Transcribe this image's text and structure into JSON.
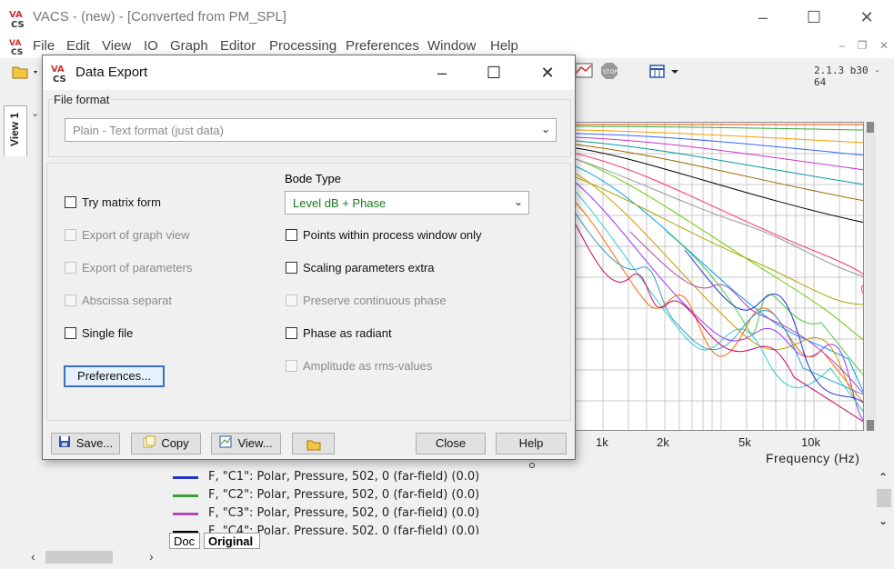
{
  "app": {
    "title": "VACS - (new) - [Converted from PM_SPL]",
    "version": "2.1.3 b30 - 64"
  },
  "menu": [
    "File",
    "Edit",
    "View",
    "IO",
    "Graph",
    "Editor",
    "Processing",
    "Preferences",
    "Window",
    "Help"
  ],
  "view_tab": "View 1",
  "graph": {
    "x_ticks": [
      "1k",
      "2k",
      "5k",
      "10k"
    ],
    "x_label": "Frequency (Hz)"
  },
  "legend": [
    {
      "text": "F, \"C1\": Polar, Pressure, 502, 0 (far-field) (0.0)",
      "color": "#2233cc"
    },
    {
      "text": "F, \"C2\": Polar, Pressure, 502, 0 (far-field) (0.0)",
      "color": "#3aa03a"
    },
    {
      "text": "F, \"C3\": Polar, Pressure, 502, 0 (far-field) (0.0)",
      "color": "#b04ab0"
    },
    {
      "text": "F, \"C4\": Polar, Pressure, 502, 0 (far-field) (0.0)",
      "color": "#000000"
    }
  ],
  "bottom_tabs": [
    "Doc",
    "Original"
  ],
  "dialog": {
    "title": "Data Export",
    "file_format_label": "File format",
    "file_format_value": "Plain - Text format (just data)",
    "bode_type_label": "Bode Type",
    "bode_type_value": "Level dB + Phase",
    "left_options": [
      {
        "label": "Try matrix form",
        "checked": false,
        "enabled": true
      },
      {
        "label": "Export of graph view",
        "checked": false,
        "enabled": false
      },
      {
        "label": "Export of parameters",
        "checked": false,
        "enabled": false
      },
      {
        "label": "Abscissa separat",
        "checked": false,
        "enabled": false
      },
      {
        "label": "Single file",
        "checked": false,
        "enabled": true
      }
    ],
    "right_options": [
      {
        "label": "Points within process window only",
        "checked": false,
        "enabled": true
      },
      {
        "label": "Scaling parameters extra",
        "checked": false,
        "enabled": true
      },
      {
        "label": "Preserve continuous phase",
        "checked": false,
        "enabled": false
      },
      {
        "label": "Phase as radiant",
        "checked": false,
        "enabled": true
      },
      {
        "label": "Amplitude as rms-values",
        "checked": false,
        "enabled": false
      }
    ],
    "buttons": {
      "preferences": "Preferences...",
      "save": "Save...",
      "copy": "Copy",
      "view": "View...",
      "close": "Close",
      "help": "Help"
    }
  },
  "colors": {
    "accent": "#3b6fc7",
    "bode_text": "#1a7a1a",
    "disabled_text": "#8a8a8a"
  }
}
